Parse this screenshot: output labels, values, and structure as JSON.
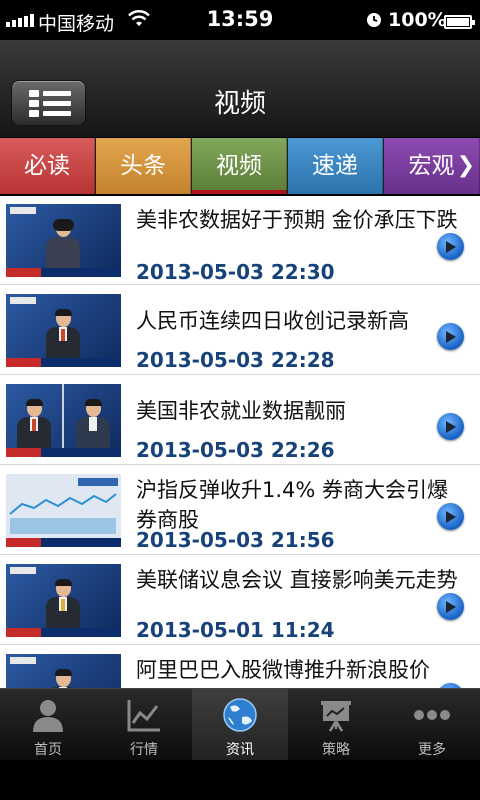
{
  "status_bar": {
    "carrier": "中国移动",
    "time": "13:59",
    "battery": "100%"
  },
  "header": {
    "title": "视频"
  },
  "tabs": [
    {
      "label": "必读",
      "color": "#c54646"
    },
    {
      "label": "头条",
      "color": "#d4943b"
    },
    {
      "label": "视频",
      "color": "#6e9348",
      "active": true
    },
    {
      "label": "速递",
      "color": "#3a86c2"
    },
    {
      "label": "宏观",
      "color": "#7a3d9c",
      "arrow": "❯"
    }
  ],
  "news": [
    {
      "title": "美非农数据好于预期 金价承压下跌",
      "time": "2013-05-03 22:30",
      "thumb": "anchor-woman"
    },
    {
      "title": "人民币连续四日收创记录新高",
      "time": "2013-05-03 22:28",
      "thumb": "anchor-man"
    },
    {
      "title": "美国非农就业数据靓丽",
      "time": "2013-05-03 22:26",
      "thumb": "two-anchors"
    },
    {
      "title": "沪指反弹收升1.4% 券商大会引爆券商股",
      "time": "2013-05-03 21:56",
      "thumb": "stock-chart"
    },
    {
      "title": "美联储议息会议 直接影响美元走势",
      "time": "2013-05-01 11:24",
      "thumb": "anchor-man"
    },
    {
      "title": "阿里巴巴入股微博推升新浪股价",
      "time": "",
      "thumb": "anchor-man"
    }
  ],
  "tab_bar": [
    {
      "label": "首页",
      "icon": "user-icon"
    },
    {
      "label": "行情",
      "icon": "chart-icon"
    },
    {
      "label": "资讯",
      "icon": "globe-icon",
      "active": true
    },
    {
      "label": "策略",
      "icon": "presentation-icon"
    },
    {
      "label": "更多",
      "icon": "more-icon"
    }
  ],
  "colors": {
    "accent_blue": "#17437a",
    "tab_active_underline": "#b0121e"
  }
}
